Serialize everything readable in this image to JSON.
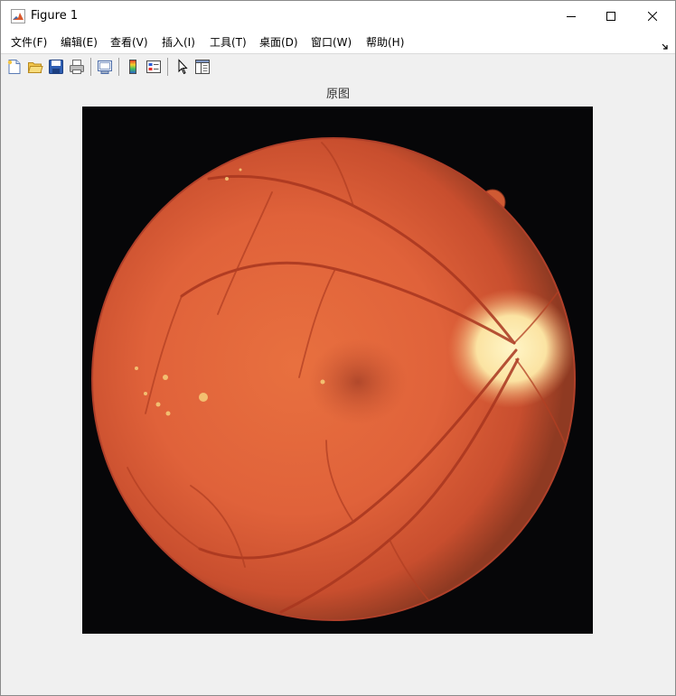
{
  "window": {
    "title": "Figure 1",
    "icon": "matlab-icon"
  },
  "menu": {
    "items": [
      {
        "label": "文件(F)",
        "name": "menu-file"
      },
      {
        "label": "编辑(E)",
        "name": "menu-edit"
      },
      {
        "label": "查看(V)",
        "name": "menu-view"
      },
      {
        "label": "插入(I)",
        "name": "menu-insert"
      },
      {
        "label": "工具(T)",
        "name": "menu-tools"
      },
      {
        "label": "桌面(D)",
        "name": "menu-desktop"
      },
      {
        "label": "窗口(W)",
        "name": "menu-window"
      },
      {
        "label": "帮助(H)",
        "name": "menu-help"
      }
    ]
  },
  "toolbar": {
    "icons": [
      "new-figure-icon",
      "open-file-icon",
      "save-icon",
      "print-icon",
      "link-plot-icon",
      "insert-colorbar-icon",
      "insert-legend-icon",
      "edit-plot-arrow-icon",
      "property-inspector-icon"
    ]
  },
  "axes": {
    "title": "原图"
  },
  "colors": {
    "figure_background": "#f0f0f0",
    "image_background": "#060608",
    "retina": "#e0623a",
    "optic_disc": "#fff0b0"
  }
}
